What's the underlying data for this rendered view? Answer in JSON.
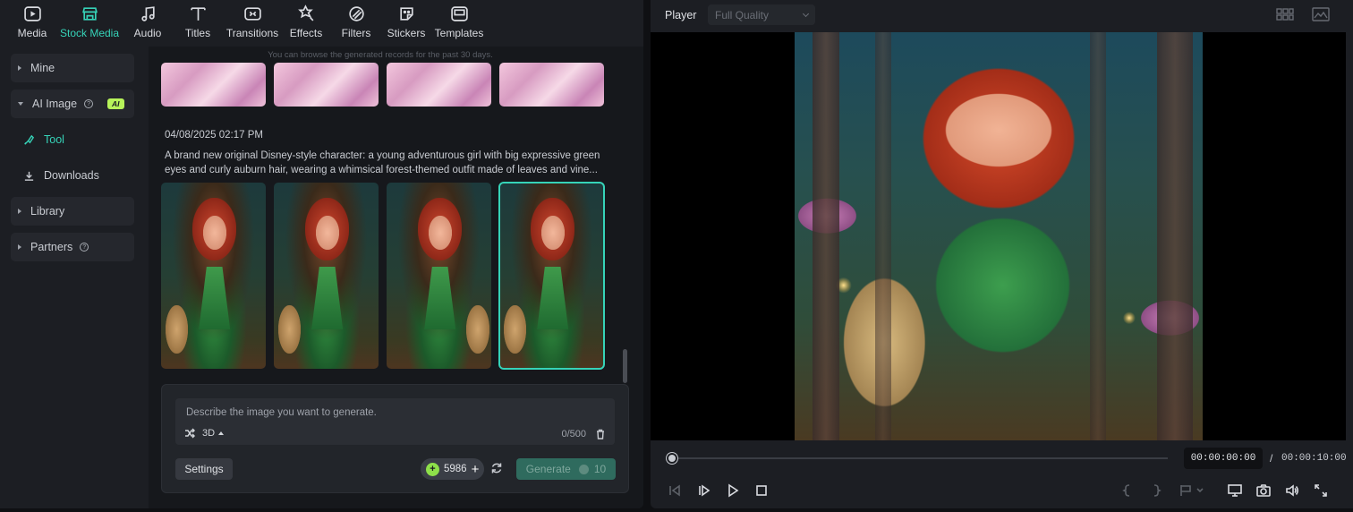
{
  "toolbar": {
    "tabs": [
      {
        "label": "Media",
        "icon": "media-icon"
      },
      {
        "label": "Stock Media",
        "icon": "stock-media-icon",
        "active": true
      },
      {
        "label": "Audio",
        "icon": "audio-icon"
      },
      {
        "label": "Titles",
        "icon": "titles-icon"
      },
      {
        "label": "Transitions",
        "icon": "transitions-icon"
      },
      {
        "label": "Effects",
        "icon": "effects-icon"
      },
      {
        "label": "Filters",
        "icon": "filters-icon"
      },
      {
        "label": "Stickers",
        "icon": "stickers-icon"
      },
      {
        "label": "Templates",
        "icon": "templates-icon"
      }
    ]
  },
  "sidebar": {
    "mine": "Mine",
    "ai_image": "AI Image",
    "ai_badge": "AI",
    "tool": "Tool",
    "downloads": "Downloads",
    "library": "Library",
    "partners": "Partners"
  },
  "content": {
    "notice": "You can browse the generated records for the past 30 days.",
    "record": {
      "date": "04/08/2025 02:17 PM",
      "prompt": "A brand new original Disney-style character: a young adventurous girl with big expressive green eyes and curly auburn hair, wearing a whimsical forest-themed outfit made of leaves and vine..."
    },
    "generator": {
      "placeholder": "Describe the image you want to generate.",
      "style": "3D",
      "char_count": "0/500",
      "settings_label": "Settings",
      "credits": "5986",
      "generate_label": "Generate",
      "generate_cost": "10"
    }
  },
  "player": {
    "title": "Player",
    "quality": "Full Quality",
    "current_time": "00:00:00:00",
    "separator": "/",
    "total_time": "00:00:10:00",
    "progress": 0
  },
  "colors": {
    "accent": "#36d3b8",
    "ai_badge": "#b7f35a",
    "credits_coin": "#8ee04a"
  }
}
